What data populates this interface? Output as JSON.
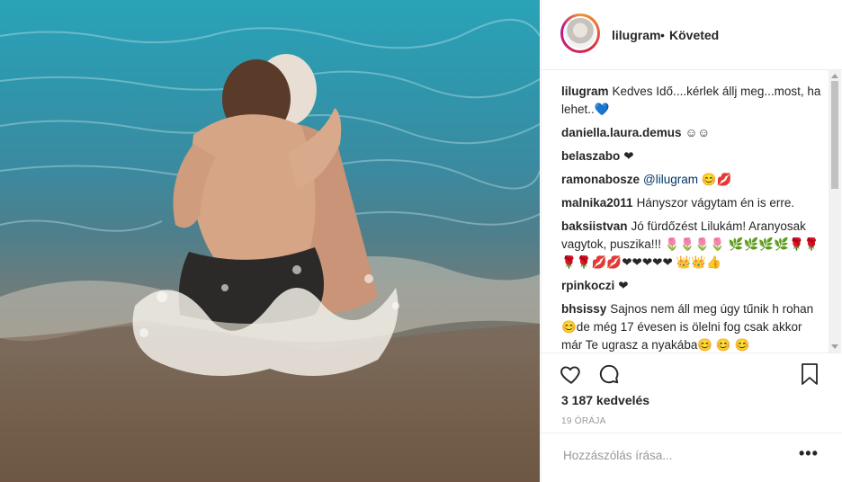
{
  "post": {
    "username": "lilugram",
    "separator": "•",
    "follow_status": "Követed",
    "likes": "3 187 kedvelés",
    "time": "19 ÓRÁJA",
    "add_comment_placeholder": "Hozzászólás írása...",
    "more_label": "•••"
  },
  "comments": [
    {
      "user": "lilugram",
      "text": "Kedves Idő....kérlek állj meg...most, ha lehet..💙"
    },
    {
      "user": "daniella.laura.demus",
      "text": "☺☺"
    },
    {
      "user": "belaszabo",
      "text": "❤"
    },
    {
      "user": "ramonabosze",
      "mention": "@lilugram",
      "text": " 😊💋"
    },
    {
      "user": "malnika2011",
      "text": "Hányszor vágytam én is erre."
    },
    {
      "user": "baksiistvan",
      "text": "Jó fürdőzést Lilukám! Aranyosak vagytok, puszika!!! 🌷🌷🌷🌷 🌿🌿🌿🌿🌹🌹🌹🌹💋💋❤❤❤❤❤ 👑👑👍"
    },
    {
      "user": "rpinkoczi",
      "text": "❤"
    },
    {
      "user": "bhsissy",
      "text": "Sajnos nem áll meg úgy tűnik h rohan😊de még 17 évesen is ölelni fog csak akkor már Te ugrasz a nyakába😊 😊 😊"
    }
  ],
  "icons": {
    "like": "heart-icon",
    "comment": "comment-bubble-icon",
    "save": "bookmark-icon",
    "more": "more-dots-icon"
  },
  "colors": {
    "text": "#262626",
    "secondary": "#999999",
    "border": "#efefef",
    "mention": "#003569"
  }
}
